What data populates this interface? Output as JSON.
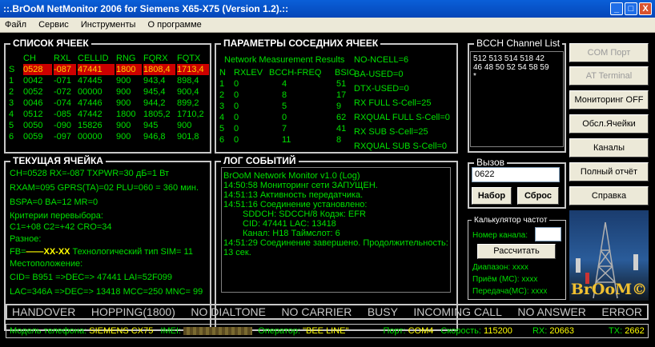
{
  "window": {
    "title": "::.BrOoM NetMonitor 2006 for Siemens X65-X75 (Version 1.2).::",
    "minimize": "_",
    "maximize": "□",
    "close": "X"
  },
  "menu": [
    "Файл",
    "Сервис",
    "Инструменты",
    "О программе"
  ],
  "cells_panel": {
    "title": "СПИСОК ЯЧЕЕК",
    "headers": [
      "CH",
      "RXL",
      "CELLID",
      "RNG",
      "FQRX",
      "FQTX"
    ],
    "rows": [
      [
        "S",
        "0528",
        "-087",
        "47441",
        "1800",
        "1808,4",
        "1713,4"
      ],
      [
        "1",
        "0042",
        "-071",
        "47445",
        "900",
        "943,4",
        "898,4"
      ],
      [
        "2",
        "0052",
        "-072",
        "00000",
        "900",
        "945,4",
        "900,4"
      ],
      [
        "3",
        "0046",
        "-074",
        "47446",
        "900",
        "944,2",
        "899,2"
      ],
      [
        "4",
        "0512",
        "-085",
        "47442",
        "1800",
        "1805,2",
        "1710,2"
      ],
      [
        "5",
        "0050",
        "-090",
        "15826",
        "900",
        "945",
        "900"
      ],
      [
        "6",
        "0059",
        "-097",
        "00000",
        "900",
        "946,8",
        "901,8"
      ]
    ]
  },
  "neigh_panel": {
    "title": "ПАРАМЕТРЫ СОСЕДНИХ ЯЧЕЕК",
    "subtitle": "Network Measurement Results",
    "headers": [
      "N",
      "RXLEV",
      "BCCH-FREQ",
      "BSIC"
    ],
    "rows": [
      [
        "1",
        "0",
        "4",
        "51"
      ],
      [
        "2",
        "0",
        "8",
        "17"
      ],
      [
        "3",
        "0",
        "5",
        "9"
      ],
      [
        "4",
        "0",
        "0",
        "62"
      ],
      [
        "5",
        "0",
        "7",
        "41"
      ],
      [
        "6",
        "0",
        "11",
        "8"
      ]
    ],
    "params": [
      "NO-NCELL=6",
      "BA-USED=0",
      "DTX-USED=0",
      "RX FULL S-Cell=25",
      "RXQUAL FULL S-Cell=0",
      "RX SUB S-Cell=25",
      "RXQUAL SUB S-Cell=0"
    ]
  },
  "current_panel": {
    "title": "ТЕКУЩАЯ ЯЧЕЙКА",
    "line1": "CH=0528    RX=-087    TXPWR=30 дБ=1 Вт",
    "line2": "RXAM=095  GPRS(TA)=02  PLU=060 = 360 мин.",
    "line3": "BSPA=0    BA=12    MR=0",
    "line4": "Критерии перевыбора:",
    "line5": "C1=+08    C2=+42    CRO=34",
    "line6": "Разное:",
    "line7a": "FB=",
    "line7b": "——XX-XX",
    "line7c": "   Технологический тип SIM=  11",
    "line8": "Местоположение:",
    "line9": "CID= B951 =>DEC=> 47441    LAI=52F099",
    "line10": "LAC=346A =>DEC=> 13418     MCC=250  MNC= 99"
  },
  "log_panel": {
    "title": "ЛОГ СОБЫТИЙ",
    "lines": [
      "BrOoM Network Monitor v1.0 (Log)",
      "14:50:58 Мониторинг сети ЗАПУЩЕН.",
      "14:51:13 Активность передатчика.",
      "14:51:16 Соединение установлено:",
      "        SDDCH: SDCCH/8 Кодэк: EFR",
      "        CID: 47441 LAC: 13418",
      "        Канал: H18  Таймслот: 6",
      "14:51:29 Соединение завершено. Продолжительность:",
      "13 сек."
    ]
  },
  "bcch_panel": {
    "title": "BCCH Channel List",
    "lines": [
      "512 513 514 518 42",
      "46 48 50 52 54 58 59",
      "*"
    ]
  },
  "call_panel": {
    "title": "Вызов",
    "number": "0622",
    "dial": "Набор",
    "reset": "Сброс"
  },
  "calc_panel": {
    "title": "Калькулятор частот",
    "channel_label": "Номер канала:",
    "channel_value": "",
    "calc_button": "Рассчитать",
    "range": "Диапазон: xxxx",
    "rx": "Приём (МС): xxxx",
    "tx": "Передача(МС): xxxx"
  },
  "side_buttons": {
    "com": "COM Порт",
    "at": "AT Terminal",
    "monitor": "Мониторинг OFF",
    "cells": "Обсл.Ячейки",
    "channels": "Каналы",
    "report": "Полный отчёт",
    "help": "Справка"
  },
  "logo": {
    "text": "BrOoM©"
  },
  "status": [
    "HANDOVER",
    "HOPPING(1800)",
    "NO DIALTONE",
    "NO CARRIER",
    "BUSY",
    "INCOMING CALL",
    "NO ANSWER",
    "ERROR"
  ],
  "info": {
    "model_label": "Модель телефона:",
    "model": "SIEMENS CX75",
    "imei_label": "IMEI:",
    "operator_label": "Оператор:",
    "operator": "\"BEE LINE\"",
    "port_label": "Порт:",
    "port": "COM4",
    "speed_label": "Скорость:",
    "speed": "115200",
    "rx_label": "RX:",
    "rx": "20663",
    "tx_label": "TX:",
    "tx": "2662"
  },
  "colors": {
    "green": "#00e000",
    "yellow": "#ffff00",
    "highlight": "#cc0000"
  }
}
